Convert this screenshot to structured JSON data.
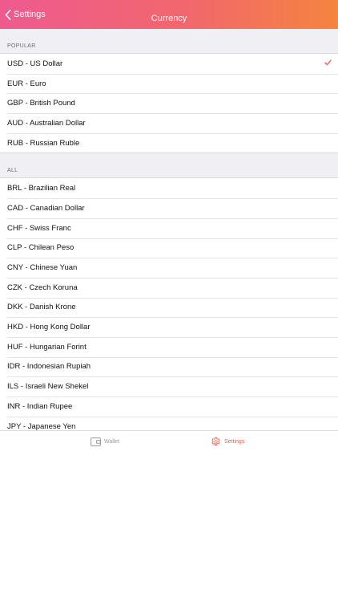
{
  "navbar": {
    "back_label": "Settings",
    "title": "Currency",
    "gradient": [
      "#ee5a90",
      "#f5843f"
    ]
  },
  "sections": [
    {
      "header": "POPULAR",
      "items": [
        {
          "label": "USD - US Dollar",
          "selected": true
        },
        {
          "label": "EUR - Euro"
        },
        {
          "label": "GBP - British Pound"
        },
        {
          "label": "AUD - Australian Dollar"
        },
        {
          "label": "RUB - Russian Ruble"
        }
      ]
    },
    {
      "header": "ALL",
      "items": [
        {
          "label": "BRL - Brazilian Real"
        },
        {
          "label": "CAD - Canadian Dollar"
        },
        {
          "label": "CHF - Swiss Franc"
        },
        {
          "label": "CLP - Chilean Peso"
        },
        {
          "label": "CNY - Chinese Yuan"
        },
        {
          "label": "CZK - Czech Koruna"
        },
        {
          "label": "DKK - Danish Krone"
        },
        {
          "label": "HKD - Hong Kong Dollar"
        },
        {
          "label": "HUF - Hungarian Forint"
        },
        {
          "label": "IDR - Indonesian Rupiah"
        },
        {
          "label": "ILS - Israeli New Shekel"
        },
        {
          "label": "INR - Indian Rupee"
        },
        {
          "label": "JPY - Japanese Yen"
        }
      ]
    }
  ],
  "check_color": "#ef5c4f",
  "tabbar": {
    "tabs": [
      {
        "label": "Wallet",
        "icon": "wallet-icon",
        "active": false
      },
      {
        "label": "Settings",
        "icon": "gear-icon",
        "active": true
      }
    ],
    "active_color": "#ef5c4f",
    "inactive_color": "#9a9a9f"
  }
}
